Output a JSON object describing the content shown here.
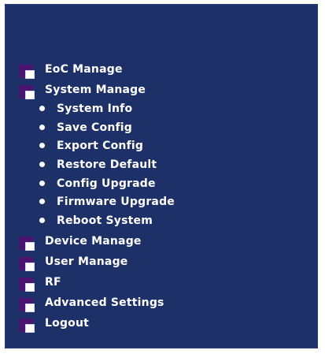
{
  "menu": {
    "eoc_manage": "EoC Manage",
    "system_manage": {
      "label": "System Manage",
      "children": [
        "System Info",
        "Save Config",
        "Export Config",
        "Restore Default",
        "Config Upgrade",
        "Firmware Upgrade",
        "Reboot System"
      ]
    },
    "device_manage": "Device Manage",
    "user_manage": "User Manage",
    "rf": "RF",
    "advanced_settings": "Advanced Settings",
    "logout": "Logout"
  },
  "colors": {
    "panel_bg": "#1e3068",
    "folder_back": "#4a1470",
    "text": "#ffffff"
  },
  "icons": {
    "menu_folder": "folder-icon",
    "sub_bullet": "bullet-icon"
  }
}
